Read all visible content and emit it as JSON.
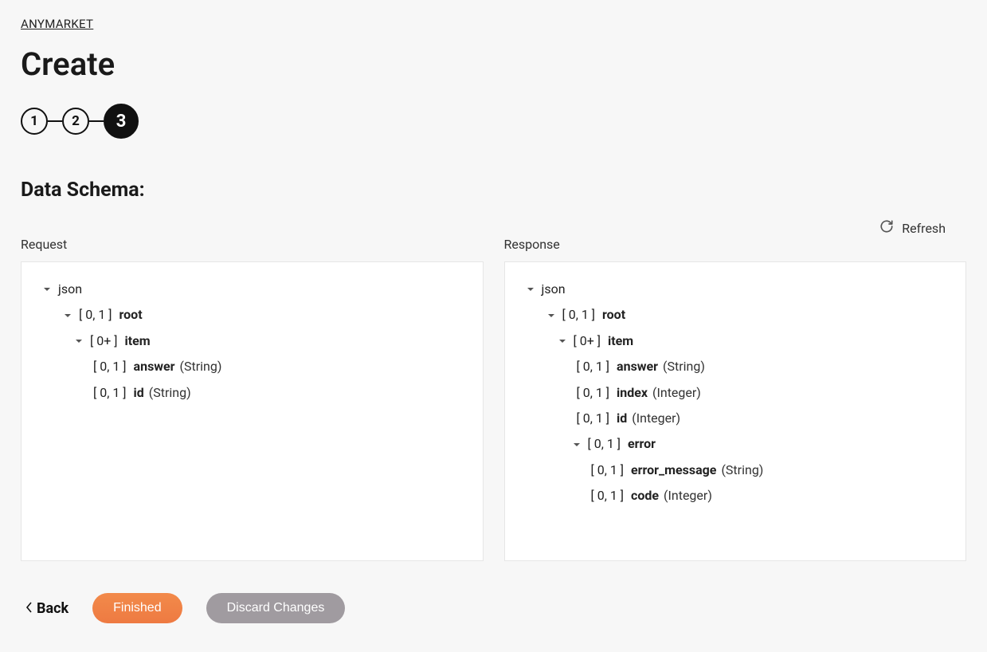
{
  "breadcrumb": "ANYMARKET",
  "page_title": "Create",
  "steps": [
    {
      "num": "1",
      "active": false
    },
    {
      "num": "2",
      "active": false
    },
    {
      "num": "3",
      "active": true
    }
  ],
  "section_title": "Data Schema:",
  "refresh_label": "Refresh",
  "panels": {
    "request": {
      "label": "Request",
      "root_label": "json",
      "rows": [
        {
          "indent": "ind-1",
          "chev": true,
          "range": "[ 0, 1 ]",
          "name": "root",
          "type": ""
        },
        {
          "indent": "ind-2",
          "chev": true,
          "range": "[ 0+ ]",
          "name": "item",
          "type": ""
        },
        {
          "indent": "ind-3",
          "chev": false,
          "range": "[ 0, 1 ]",
          "name": "answer",
          "type": "(String)"
        },
        {
          "indent": "ind-3",
          "chev": false,
          "range": "[ 0, 1 ]",
          "name": "id",
          "type": "(String)"
        }
      ]
    },
    "response": {
      "label": "Response",
      "root_label": "json",
      "rows": [
        {
          "indent": "ind-1",
          "chev": true,
          "range": "[ 0, 1 ]",
          "name": "root",
          "type": ""
        },
        {
          "indent": "ind-2",
          "chev": true,
          "range": "[ 0+ ]",
          "name": "item",
          "type": ""
        },
        {
          "indent": "ind-3",
          "chev": false,
          "range": "[ 0, 1 ]",
          "name": "answer",
          "type": "(String)"
        },
        {
          "indent": "ind-3",
          "chev": false,
          "range": "[ 0, 1 ]",
          "name": "index",
          "type": "(Integer)"
        },
        {
          "indent": "ind-3",
          "chev": false,
          "range": "[ 0, 1 ]",
          "name": "id",
          "type": "(Integer)"
        },
        {
          "indent": "ind-3b",
          "chev": true,
          "range": "[ 0, 1 ]",
          "name": "error",
          "type": ""
        },
        {
          "indent": "ind-4",
          "chev": false,
          "range": "[ 0, 1 ]",
          "name": "error_message",
          "type": "(String)"
        },
        {
          "indent": "ind-4",
          "chev": false,
          "range": "[ 0, 1 ]",
          "name": "code",
          "type": "(Integer)"
        }
      ]
    }
  },
  "footer": {
    "back": "Back",
    "finished": "Finished",
    "discard": "Discard Changes"
  }
}
